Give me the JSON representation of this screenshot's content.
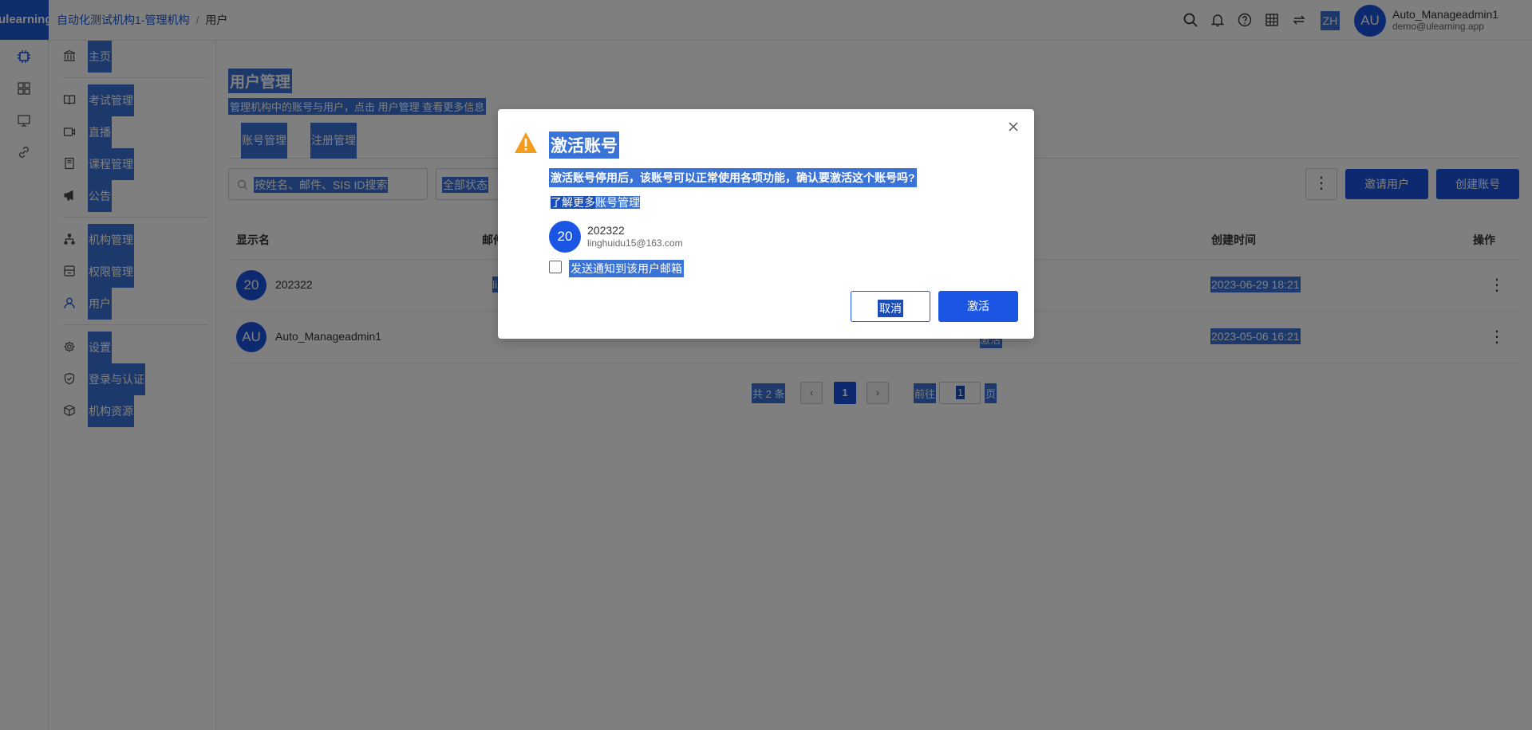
{
  "brand": "ulearning",
  "breadcrumb": {
    "org": "自动化测试机构1-管理机构",
    "current": "用户"
  },
  "topbar": {
    "lang": "ZH",
    "avatar": "AU",
    "user_name": "Auto_Manageadmin1",
    "user_email": "demo@ulearning.app"
  },
  "sidebar": {
    "items": [
      {
        "label": "主页",
        "icon": "bank-icon"
      },
      {
        "label": "考试管理",
        "icon": "book-icon"
      },
      {
        "label": "直播",
        "icon": "video-icon"
      },
      {
        "label": "课程管理",
        "icon": "course-book-icon"
      },
      {
        "label": "公告",
        "icon": "megaphone-icon"
      },
      {
        "label": "机构管理",
        "icon": "org-tree-icon"
      },
      {
        "label": "权限管理",
        "icon": "permission-icon"
      },
      {
        "label": "用户",
        "icon": "user-icon"
      },
      {
        "label": "设置",
        "icon": "gear-icon"
      },
      {
        "label": "登录与认证",
        "icon": "shield-icon"
      },
      {
        "label": "机构资源",
        "icon": "cube-icon"
      }
    ]
  },
  "page": {
    "title": "用户管理",
    "description": "管理机构中的账号与用户，点击 用户管理 查看更多信息",
    "tabs": [
      "账号管理",
      "注册管理"
    ],
    "search_placeholder": "按姓名、邮件、SIS ID搜索",
    "status_filter": "全部状态",
    "invite_button": "邀请用户",
    "create_button": "创建账号"
  },
  "table": {
    "headers": {
      "display_name": "显示名",
      "email": "邮件",
      "created": "创建时间",
      "actions": "操作"
    },
    "rows": [
      {
        "avatar": "20",
        "name": "202322",
        "email_fragment": "ling",
        "status_fragment": "",
        "created": "2023-06-29 18:21"
      },
      {
        "avatar": "AU",
        "name": "Auto_Manageadmin1",
        "email_fragment": "",
        "status_fragment": "激活",
        "created": "2023-05-06 16:21"
      }
    ]
  },
  "pagination": {
    "total": "共 2 条",
    "current_page": "1",
    "goto_label": "前往",
    "goto_value": "1",
    "page_suffix": "页"
  },
  "dialog": {
    "title": "激活账号",
    "description": "激活账号停用后，该账号可以正常使用各项功能，确认要激活这个账号吗?",
    "learn_more": "了解更多",
    "learn_more_link": "账号管理",
    "user_avatar": "20",
    "user_name": "202322",
    "user_email": "linghuidu15@163.com",
    "notify_label": "发送通知到该用户邮箱",
    "notify_checked": false,
    "cancel_button": "取消",
    "confirm_button": "激活"
  },
  "colors": {
    "primary": "#1a55e3",
    "selection": "#3a73d8",
    "warning": "#f39b1b"
  }
}
